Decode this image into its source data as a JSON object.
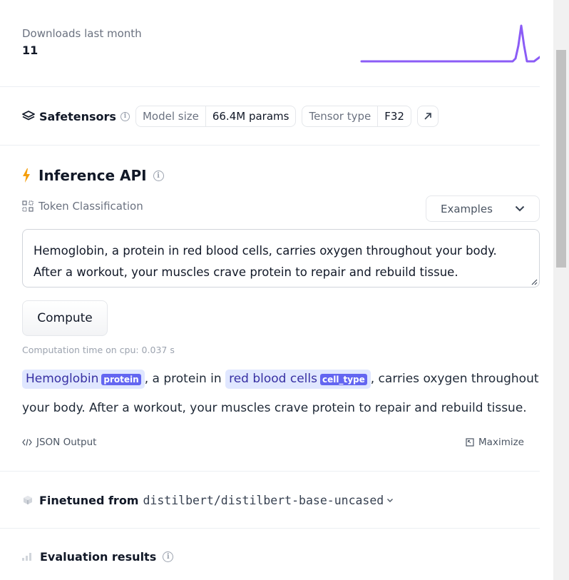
{
  "downloads": {
    "label": "Downloads last month",
    "value": "11",
    "sparkline_color": "#8b5cf6"
  },
  "safetensors": {
    "title": "Safetensors",
    "model_size_label": "Model size",
    "model_size_value": "66.4M params",
    "tensor_type_label": "Tensor type",
    "tensor_type_value": "F32",
    "link_icon": "arrow-up-right-icon"
  },
  "inference": {
    "title": "Inference API",
    "task": "Token Classification",
    "examples_label": "Examples",
    "input_line1": "Hemoglobin, a protein in red blood cells, carries oxygen throughout your body.",
    "input_line2": "After a workout, your muscles crave protein to repair and rebuild tissue.",
    "compute_label": "Compute",
    "computation_time": "Computation time on cpu: 0.037 s",
    "output": {
      "entity1_text": "Hemoglobin",
      "entity1_tag": "protein",
      "text1": ", a protein in ",
      "entity2_text": "red blood cells",
      "entity2_tag": "cell_type",
      "text2": ", carries oxygen throughout your body. After a workout, your muscles crave protein to repair and rebuild tissue."
    },
    "json_output_label": "JSON Output",
    "maximize_label": "Maximize",
    "accent_color": "#f59e0b",
    "entity_bg": "#e0e7ff",
    "tag_bg": "#6366f1"
  },
  "finetuned": {
    "title": "Finetuned from",
    "model": "distilbert/distilbert-base-uncased"
  },
  "evaluation": {
    "title": "Evaluation results"
  }
}
